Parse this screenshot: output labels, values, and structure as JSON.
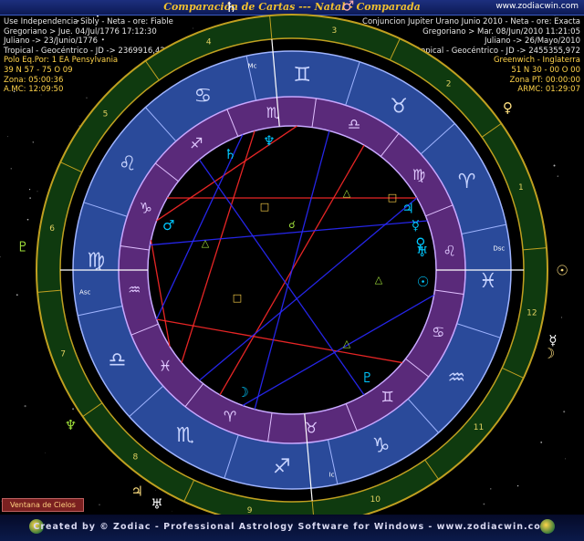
{
  "title": "Comparación de Cartas --- Natal - Comparada",
  "site": "www.zodiacwin.com",
  "left_info": [
    "Use Independencia  Sibly - Neta  -  ore: Fiable",
    "Gregoriano > Jue. 04/Jul/1776   17:12:30",
    "Juliano -> 23/Junio/1776",
    "Tropical - Geocéntrico - JD -> 2369916,425",
    "Polo Eq.Por: 1 EA Pensylvania",
    "39 N 57 - 75 O 09",
    "Zona:   05:00:36",
    "A.MC: 12:09:50"
  ],
  "right_info": [
    "Conjuncion Jupiter Urano Junio 2010 - Neta  -  ore: Exacta",
    "Gregoriano > Mar. 08/Jun/2010   11:21:05",
    "Juliano -> 26/Mayo/2010",
    "Tropical - Geocéntrico - JD -> 2455355,972",
    "Greenwich - Inglaterra",
    "51 N 30 - 00 O 00",
    "Zona PT:   00:00:00",
    "ARMC: 01:29:07"
  ],
  "wheel": {
    "signs": [
      "♈",
      "♉",
      "♊",
      "♋",
      "♌",
      "♍",
      "♎",
      "♏",
      "♐",
      "♑",
      "♒",
      "♓"
    ],
    "cusp_labels": [
      "Asc",
      "Mc",
      "Dsc",
      "Ic"
    ],
    "house_numbers": [
      "1",
      "2",
      "3",
      "4",
      "5",
      "6",
      "7",
      "8",
      "9",
      "10",
      "11",
      "12"
    ],
    "outer_planets": [
      "♄",
      "♂",
      "♀",
      "☉",
      "☿",
      "♆",
      "♅",
      "♃",
      "☽",
      "♇"
    ],
    "inner_planets": [
      "♄",
      "♆",
      "♃",
      "☿",
      "♀",
      "☉",
      "♅",
      "♇",
      "☽",
      "♂"
    ],
    "aspects": [
      "△",
      "□",
      "☌"
    ],
    "colors": {
      "outer_ring": "#1a6a1a",
      "sign_ring": "#2a4a9a",
      "house_ring": "#5a2a7a",
      "natal": "#ff2a2a",
      "transit": "#2a2aff",
      "planet": "#00c8ff"
    }
  },
  "ventana_button": "Ventana de Cielos",
  "footer": "Created by © Zodiac - Professional Astrology Software for Windows - www.zodiacwin.com"
}
